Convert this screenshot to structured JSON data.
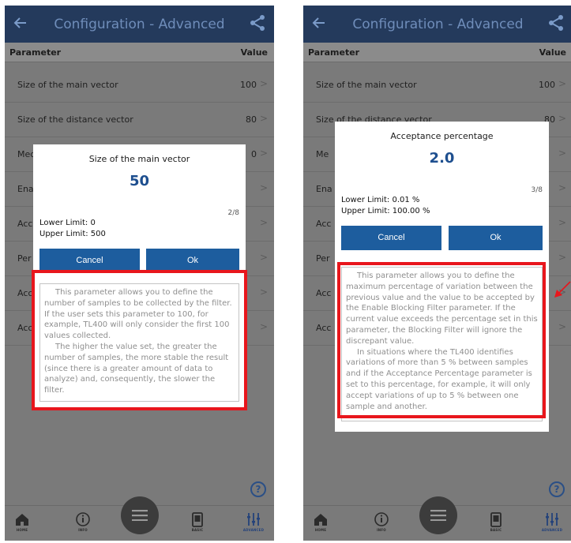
{
  "screens": [
    {
      "header_title": "Configuration - Advanced",
      "col_parameter": "Parameter",
      "col_value": "Value",
      "rows": [
        {
          "label": "Size of the main vector",
          "value": "100"
        },
        {
          "label": "Size of the distance vector",
          "value": "80"
        },
        {
          "label": "Median index",
          "value": "0"
        },
        {
          "label": "Ena",
          "value": ""
        },
        {
          "label": "Acc",
          "value": ""
        },
        {
          "label": "Per",
          "value": ""
        },
        {
          "label": "Acc",
          "value": ""
        },
        {
          "label": "Acc",
          "value": ""
        }
      ],
      "dialog": {
        "title": "Size of the main vector",
        "value": "50",
        "step": "2/8",
        "lower_limit": "Lower Limit: 0",
        "upper_limit": "Upper Limit: 500",
        "cancel": "Cancel",
        "ok": "Ok",
        "description": [
          "This parameter allows you to define the number of samples to be collected by the filter. If the user sets this parameter to 100, for example, TL400 will only consider the first 100 values collected.",
          "The higher the value set, the greater the number of samples, the more stable the result (since there is a greater amount of data to analyze) and, consequently, the slower the filter."
        ]
      }
    },
    {
      "header_title": "Configuration - Advanced",
      "col_parameter": "Parameter",
      "col_value": "Value",
      "rows": [
        {
          "label": "Size of the main vector",
          "value": "100"
        },
        {
          "label": "Size of the distance vector",
          "value": "80"
        },
        {
          "label": "Me",
          "value": ""
        },
        {
          "label": "Ena",
          "value": ""
        },
        {
          "label": "Acc",
          "value": ""
        },
        {
          "label": "Per",
          "value": ""
        },
        {
          "label": "Acc",
          "value": ""
        },
        {
          "label": "Acc",
          "value": ""
        }
      ],
      "dialog": {
        "title": "Acceptance percentage",
        "value": "2.0",
        "step": "3/8",
        "lower_limit": "Lower Limit: 0.01 %",
        "upper_limit": "Upper Limit: 100.00 %",
        "cancel": "Cancel",
        "ok": "Ok",
        "description": [
          "This parameter allows you to define the maximum percentage of variation between the previous value and the value to be accepted by the Enable Blocking Filter parameter. If the current value exceeds the percentage set in this parameter, the Blocking Filter will ignore the discrepant value.",
          "In situations where the TL400 identifies variations of more than 5 % between samples and if the Acceptance Percentage parameter is set to this percentage, for example, it will only accept variations of up to 5 % between one sample and another."
        ]
      }
    }
  ],
  "nav": {
    "home": "HOME",
    "info": "INFO",
    "basic": "BASIC",
    "advanced": "ADVANCED"
  },
  "icons": {
    "back": "back-arrow-icon",
    "share": "share-icon",
    "help": "help-icon",
    "home": "home-icon",
    "info": "info-icon",
    "menu": "menu-icon",
    "basic": "device-icon",
    "advanced": "sliders-icon"
  },
  "colors": {
    "header": "#243a5c",
    "primary_button": "#1d5d9e",
    "value_text": "#1e4f8f",
    "highlight": "#e8161c",
    "overlay": "#7a7a7a"
  }
}
